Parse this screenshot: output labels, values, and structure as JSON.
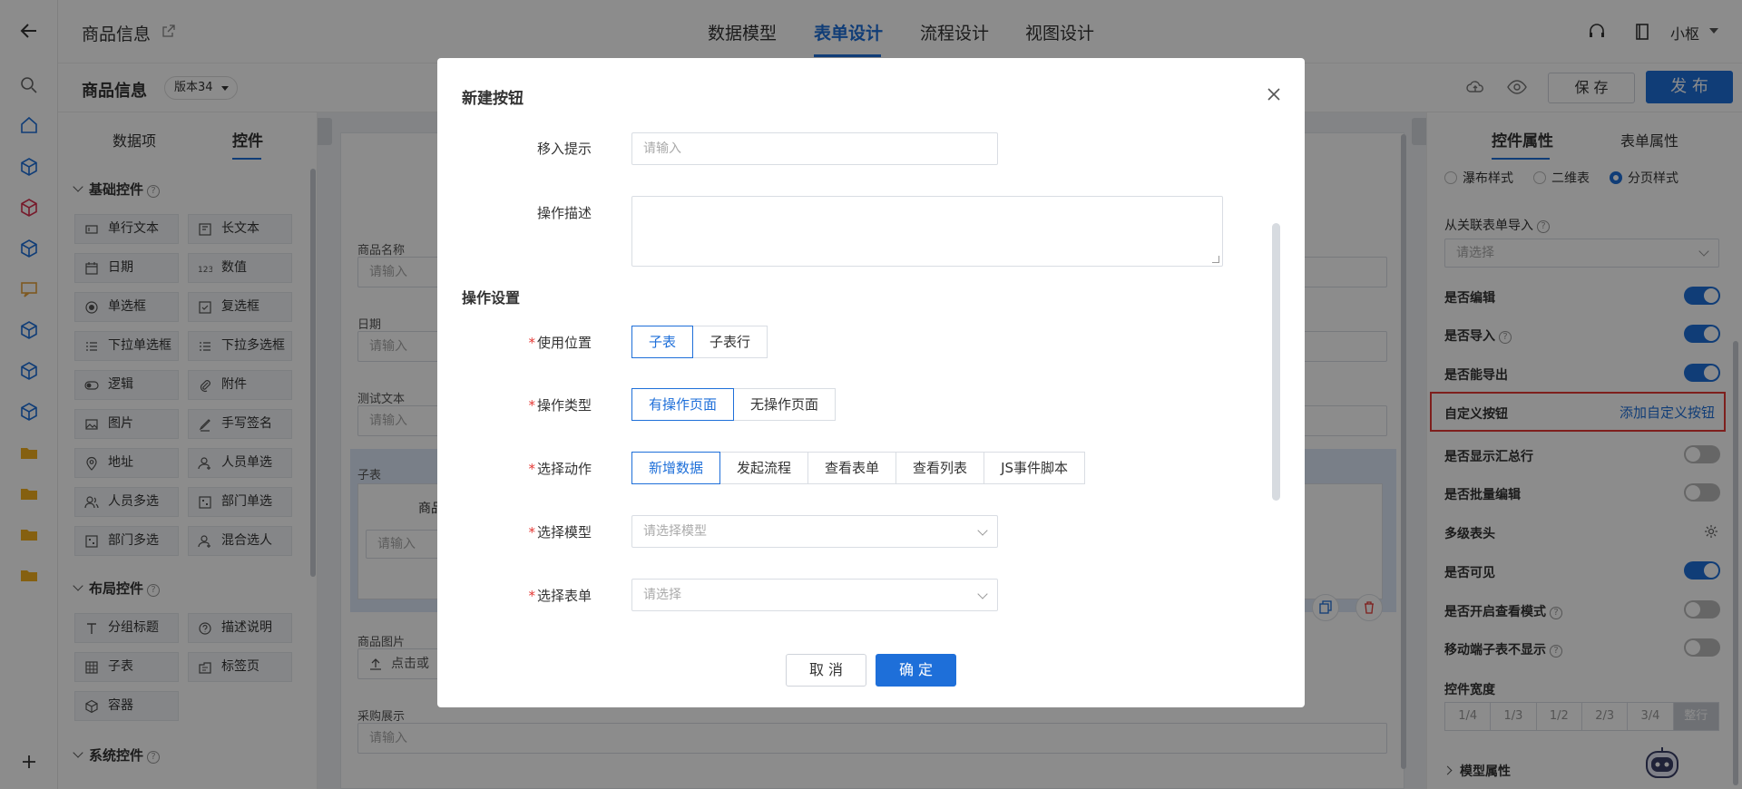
{
  "topbar": {
    "app_title": "商品信息",
    "tabs": [
      {
        "label": "数据模型"
      },
      {
        "label": "表单设计"
      },
      {
        "label": "流程设计"
      },
      {
        "label": "视图设计"
      }
    ],
    "user_name": "小枢"
  },
  "subbar": {
    "form_name": "商品信息",
    "version": "版本34",
    "save_label": "保 存",
    "publish_label": "发 布"
  },
  "left_panel": {
    "tabs": [
      {
        "label": "数据项"
      },
      {
        "label": "控件"
      }
    ],
    "groups": [
      {
        "title": "基础控件",
        "items": [
          {
            "label": "单行文本",
            "icon": "textbox-icon"
          },
          {
            "label": "长文本",
            "icon": "textarea-icon"
          },
          {
            "label": "日期",
            "icon": "calendar-icon"
          },
          {
            "label": "数值",
            "icon": "number-icon"
          },
          {
            "label": "单选框",
            "icon": "radio-icon"
          },
          {
            "label": "复选框",
            "icon": "checkbox-icon"
          },
          {
            "label": "下拉单选框",
            "icon": "list-icon"
          },
          {
            "label": "下拉多选框",
            "icon": "list-icon"
          },
          {
            "label": "逻辑",
            "icon": "switch-icon"
          },
          {
            "label": "附件",
            "icon": "paperclip-icon"
          },
          {
            "label": "图片",
            "icon": "image-icon"
          },
          {
            "label": "手写签名",
            "icon": "pen-icon"
          },
          {
            "label": "地址",
            "icon": "location-icon"
          },
          {
            "label": "人员单选",
            "icon": "user-icon"
          },
          {
            "label": "人员多选",
            "icon": "users-icon"
          },
          {
            "label": "部门单选",
            "icon": "department-icon"
          },
          {
            "label": "部门多选",
            "icon": "department-icon"
          },
          {
            "label": "混合选人",
            "icon": "user-icon"
          }
        ]
      },
      {
        "title": "布局控件",
        "items": [
          {
            "label": "分组标题",
            "icon": "title-icon"
          },
          {
            "label": "描述说明",
            "icon": "help-icon"
          },
          {
            "label": "子表",
            "icon": "table-icon"
          },
          {
            "label": "标签页",
            "icon": "tabs-icon"
          },
          {
            "label": "容器",
            "icon": "cube-icon"
          }
        ]
      },
      {
        "title": "系统控件",
        "items": []
      }
    ]
  },
  "canvas": {
    "fields": [
      {
        "label": "商品名称",
        "placeholder": "请输入"
      },
      {
        "label": "日期",
        "placeholder": "请输入"
      },
      {
        "label": "测试文本",
        "placeholder": "请输入"
      }
    ],
    "subtable": {
      "label": "子表",
      "col_header": "商品",
      "placeholder": "请输入"
    },
    "image_field": {
      "label": "商品图片",
      "upload_label": "点击或"
    },
    "purchase_field": {
      "label": "采购展示",
      "placeholder": "请输入"
    }
  },
  "right_panel": {
    "tabs": [
      {
        "label": "控件属性"
      },
      {
        "label": "表单属性"
      }
    ],
    "style_options": [
      {
        "label": "瀑布样式",
        "selected": false
      },
      {
        "label": "二维表",
        "selected": false
      },
      {
        "label": "分页样式",
        "selected": true
      }
    ],
    "import_label": "从关联表单导入",
    "import_placeholder": "请选择",
    "rows": [
      {
        "label": "是否编辑",
        "on": true
      },
      {
        "label": "是否导入",
        "on": true,
        "help": true
      },
      {
        "label": "是否能导出",
        "on": true
      }
    ],
    "custom_button": {
      "label": "自定义按钮",
      "action": "添加自定义按钮"
    },
    "rows2": [
      {
        "label": "是否显示汇总行",
        "on": false
      },
      {
        "label": "是否批量编辑",
        "on": false
      }
    ],
    "multi_header": "多级表头",
    "rows3": [
      {
        "label": "是否可见",
        "on": true
      },
      {
        "label": "是否开启查看模式",
        "on": false,
        "help": true
      },
      {
        "label": "移动端子表不显示",
        "on": false,
        "help": true
      }
    ],
    "width_label": "控件宽度",
    "width_options": [
      "1/4",
      "1/3",
      "1/2",
      "2/3",
      "3/4",
      "整行"
    ],
    "model_props": "模型属性"
  },
  "modal": {
    "title": "新建按钮",
    "move_tip_label": "移入提示",
    "move_tip_placeholder": "请输入",
    "desc_label": "操作描述",
    "section_title": "操作设置",
    "position": {
      "label": "使用位置",
      "options": [
        "子表",
        "子表行"
      ],
      "selected": 0
    },
    "op_type": {
      "label": "操作类型",
      "options": [
        "有操作页面",
        "无操作页面"
      ],
      "selected": 0
    },
    "action": {
      "label": "选择动作",
      "options": [
        "新增数据",
        "发起流程",
        "查看表单",
        "查看列表",
        "JS事件脚本"
      ],
      "selected": 0
    },
    "model": {
      "label": "选择模型",
      "placeholder": "请选择模型"
    },
    "form": {
      "label": "选择表单",
      "placeholder": "请选择"
    },
    "cancel_label": "取 消",
    "ok_label": "确 定"
  },
  "colors": {
    "primary": "#1e6fd9",
    "highlight_border": "#e53935",
    "required": "#e53935"
  }
}
